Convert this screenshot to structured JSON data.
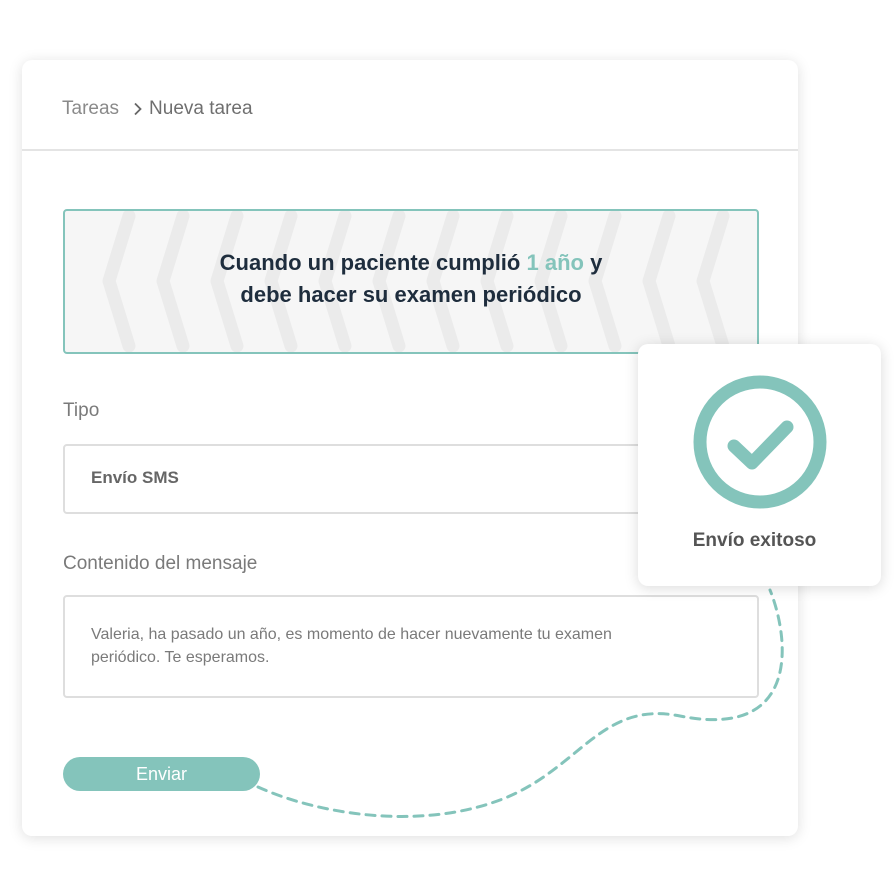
{
  "breadcrumb": {
    "parent": "Tareas",
    "current": "Nueva tarea",
    "separator_icon": "chevron-right-icon"
  },
  "trigger": {
    "line1_before": "Cuando un paciente cumplió",
    "line1_highlight": "1 año",
    "line1_after": "y",
    "line2": "debe hacer su examen periódico"
  },
  "tipo": {
    "label": "Tipo",
    "value": "Envío SMS"
  },
  "mensaje": {
    "label": "Contenido del mensaje",
    "value": "Valeria, ha pasado un año, es momento de hacer nuevamente tu examen periódico. Te esperamos."
  },
  "actions": {
    "send_label": "Enviar"
  },
  "toast": {
    "message": "Envío exitoso",
    "icon": "check-circle-icon"
  },
  "colors": {
    "accent": "#84c4bb",
    "heading": "#1e2d3d",
    "muted_text": "#7a7a7a",
    "card_bg": "#ffffff",
    "trigger_bg": "#f6f6f6"
  }
}
